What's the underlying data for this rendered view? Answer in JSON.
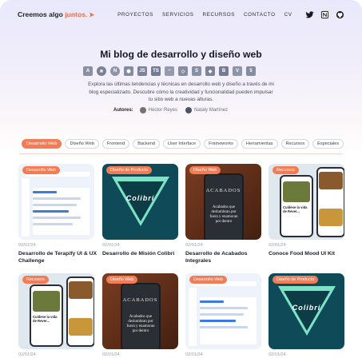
{
  "nav": {
    "brand_prefix": "Creemos algo",
    "brand_accent": "juntos.",
    "brand_icon": "rocket-icon",
    "links": [
      "PROYECTOS",
      "SERVICIOS",
      "RECURSOS",
      "CONTACTO",
      "CV"
    ],
    "social": [
      "twitter-icon",
      "notion-icon",
      "github-icon"
    ]
  },
  "hero": {
    "title": "Mi blog de desarrollo y diseño web",
    "tech_icons": [
      "angular-icon",
      "react-icon",
      "nuxt-icon",
      "nodejs-icon",
      "js-icon",
      "ts-icon",
      "tailwind-icon",
      "codepen-icon",
      "sass-icon",
      "git-icon",
      "bootstrap-icon",
      "vite-icon",
      "html-icon"
    ],
    "description": "Explora las últimas tendencias y técnicas en desarrollo web y diseño a través de mi blog especializado. Descubre cómo la creatividad y funcionalidad pueden impulsar tu sitio web a nuevas alturas.",
    "authors_label": "Autores:",
    "authors": [
      "Héctor Reyes",
      "Nataly Martínez"
    ]
  },
  "filters": [
    "Desarrollo Web",
    "Diseño Web",
    "Frontend",
    "Backend",
    "User Interface",
    "Frameworks",
    "Herramientas",
    "Recursos",
    "Especiales"
  ],
  "active_filter": "Desarrollo Web",
  "accent_color": "#f47c55",
  "cards": [
    {
      "badge": "Desarrollo Web",
      "date": "02/01/24",
      "title": "Desarrollo de Terapify UI & UX Challenge"
    },
    {
      "badge": "Diseño de Producto",
      "date": "02/01/24",
      "title": "Desarrollo de Misión Colibrí",
      "thumb_word": "Colibrí"
    },
    {
      "badge": "Diseño Web",
      "date": "02/01/24",
      "title": "Desarrollo de Acabados Integrales",
      "thumb_logo": "ACABADOS",
      "thumb_text": "Acabados que deslumbran por fuera y enamoran por dentro"
    },
    {
      "badge": "Recursos",
      "date": "02/01/24",
      "title": "Conoce Food Mood UI Kit",
      "thumb_text": "Cuídese la vida de Rever..."
    },
    {
      "badge": "Recursos",
      "date": "02/01/24",
      "title": ""
    },
    {
      "badge": "Diseño Web",
      "date": "02/01/24",
      "title": ""
    },
    {
      "badge": "Desarrollo Web",
      "date": "02/01/24",
      "title": ""
    },
    {
      "badge": "Diseño de Producto",
      "date": "02/01/24",
      "title": ""
    }
  ]
}
